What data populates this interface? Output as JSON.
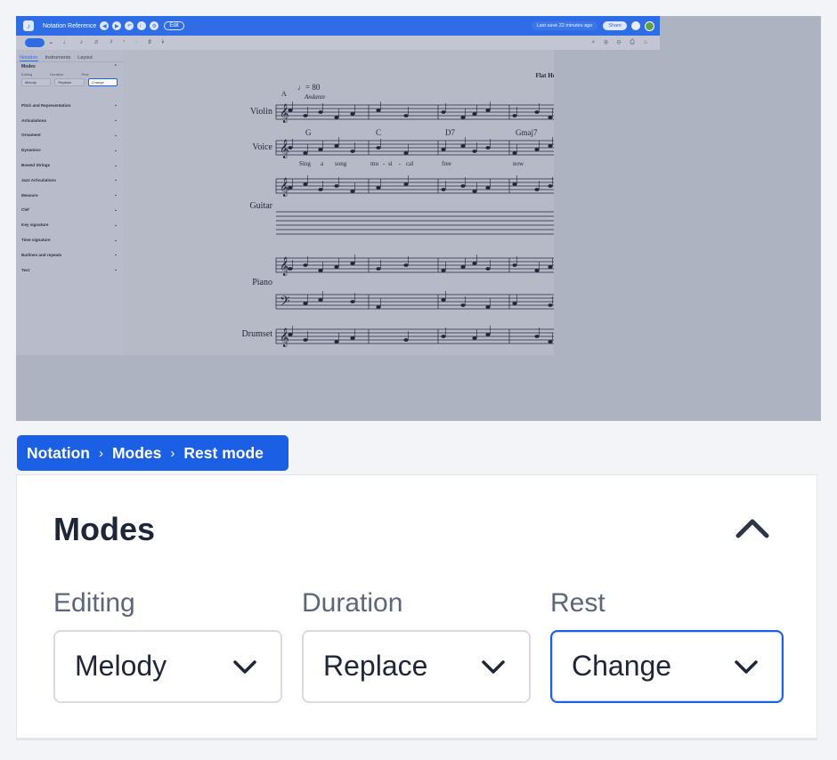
{
  "app": {
    "doc_title": "Notation Reference",
    "edit_button": "Edit",
    "last_save": "Last save 22 minutes ago",
    "share_button": "Share"
  },
  "sidebar": {
    "tabs": [
      "Notation",
      "Instruments",
      "Layout"
    ],
    "modes_title": "Modes",
    "mode_labels": [
      "Editing",
      "Duration",
      "Rest"
    ],
    "mode_values": [
      "Melody",
      "Replace",
      "Change"
    ],
    "sections": [
      "Pitch and Representation",
      "Articulations",
      "Ornament",
      "Dynamics",
      "Bowed Strings",
      "Jazz Articulations",
      "Measure",
      "Clef",
      "Key signature",
      "Time signature",
      "Barlines and repeats",
      "Text"
    ]
  },
  "score": {
    "header": "Flat Help Center",
    "rehearsal_mark": "A",
    "tempo": "♩= 80",
    "tempo_text": "Andante",
    "instruments": [
      "Violin",
      "Voice",
      "Guitar",
      "Piano",
      "Drumset"
    ],
    "chords": [
      "G",
      "C",
      "D7",
      "Gmaj7"
    ],
    "lyrics": [
      "Sing",
      "a",
      "song",
      "mu",
      "-",
      "si",
      "-",
      "cal",
      "free",
      "now"
    ]
  },
  "breadcrumb": {
    "items": [
      "Notation",
      "Modes",
      "Rest mode"
    ],
    "separator": "›"
  },
  "panel": {
    "title": "Modes",
    "fields": [
      {
        "label": "Editing",
        "value": "Melody"
      },
      {
        "label": "Duration",
        "value": "Replace"
      },
      {
        "label": "Rest",
        "value": "Change"
      }
    ]
  },
  "colors": {
    "accent": "#1b5fe4",
    "title_text": "#1f2638",
    "label_text": "#5d6678"
  }
}
